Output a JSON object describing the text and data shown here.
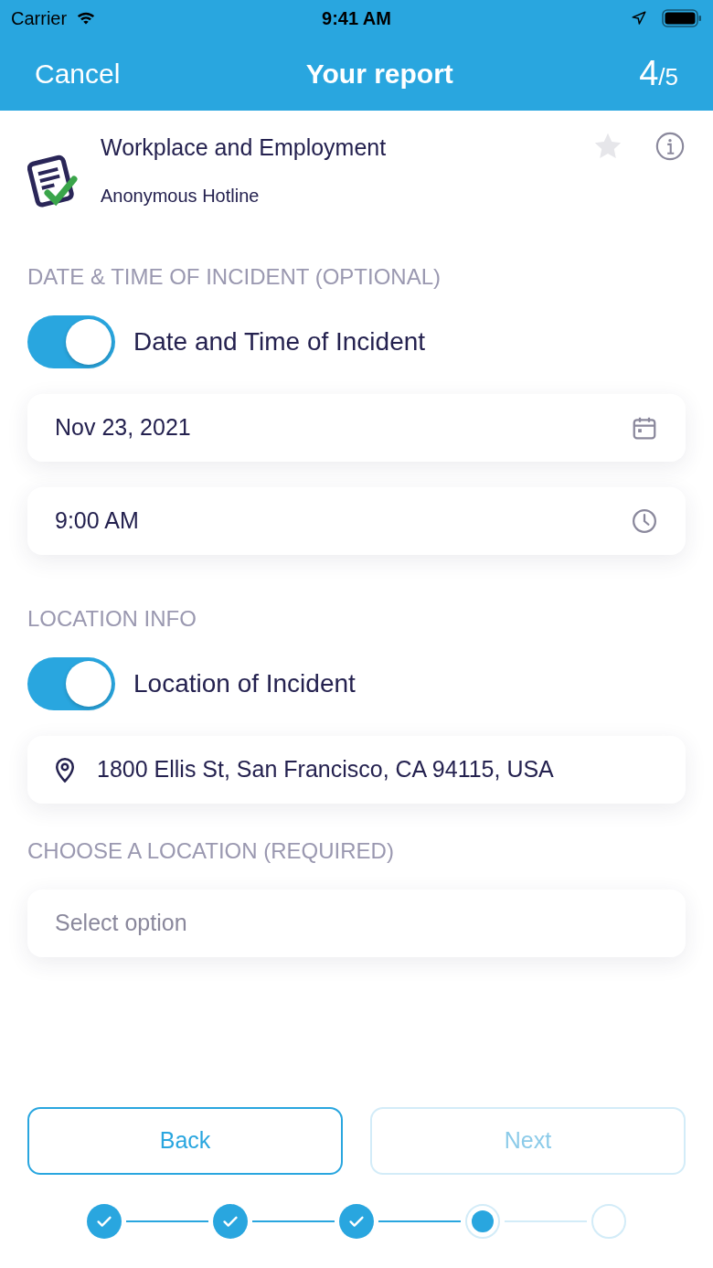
{
  "status_bar": {
    "carrier": "Carrier",
    "time": "9:41 AM"
  },
  "header": {
    "cancel": "Cancel",
    "title": "Your report",
    "step_current": "4",
    "step_total": "/5"
  },
  "category": {
    "title": "Workplace and Employment",
    "subtitle": "Anonymous Hotline",
    "favorite": false
  },
  "sections": [
    {
      "kind": "toggle-fields",
      "heading": "DATE & TIME OF INCIDENT (OPTIONAL)",
      "toggle": {
        "label": "Date and Time of Incident",
        "on": true
      },
      "fields": [
        {
          "value": "Nov 23, 2021",
          "kind": "date"
        },
        {
          "value": "9:00 AM",
          "kind": "time"
        }
      ]
    },
    {
      "kind": "toggle-fields",
      "heading": "LOCATION INFO",
      "toggle": {
        "label": "Location of Incident",
        "on": true
      },
      "fields": [
        {
          "value": "1800 Ellis St, San Francisco, CA 94115, USA",
          "kind": "address"
        }
      ]
    },
    {
      "kind": "select",
      "heading": "CHOOSE A LOCATION (REQUIRED)",
      "placeholder": "Select option"
    }
  ],
  "buttons": [
    {
      "label": "Back",
      "disabled": false
    },
    {
      "label": "Next",
      "disabled": true
    }
  ],
  "steps": [
    {
      "kind": "done"
    },
    {
      "kind": "done"
    },
    {
      "kind": "done"
    },
    {
      "kind": "current"
    },
    {
      "kind": "todo"
    }
  ]
}
